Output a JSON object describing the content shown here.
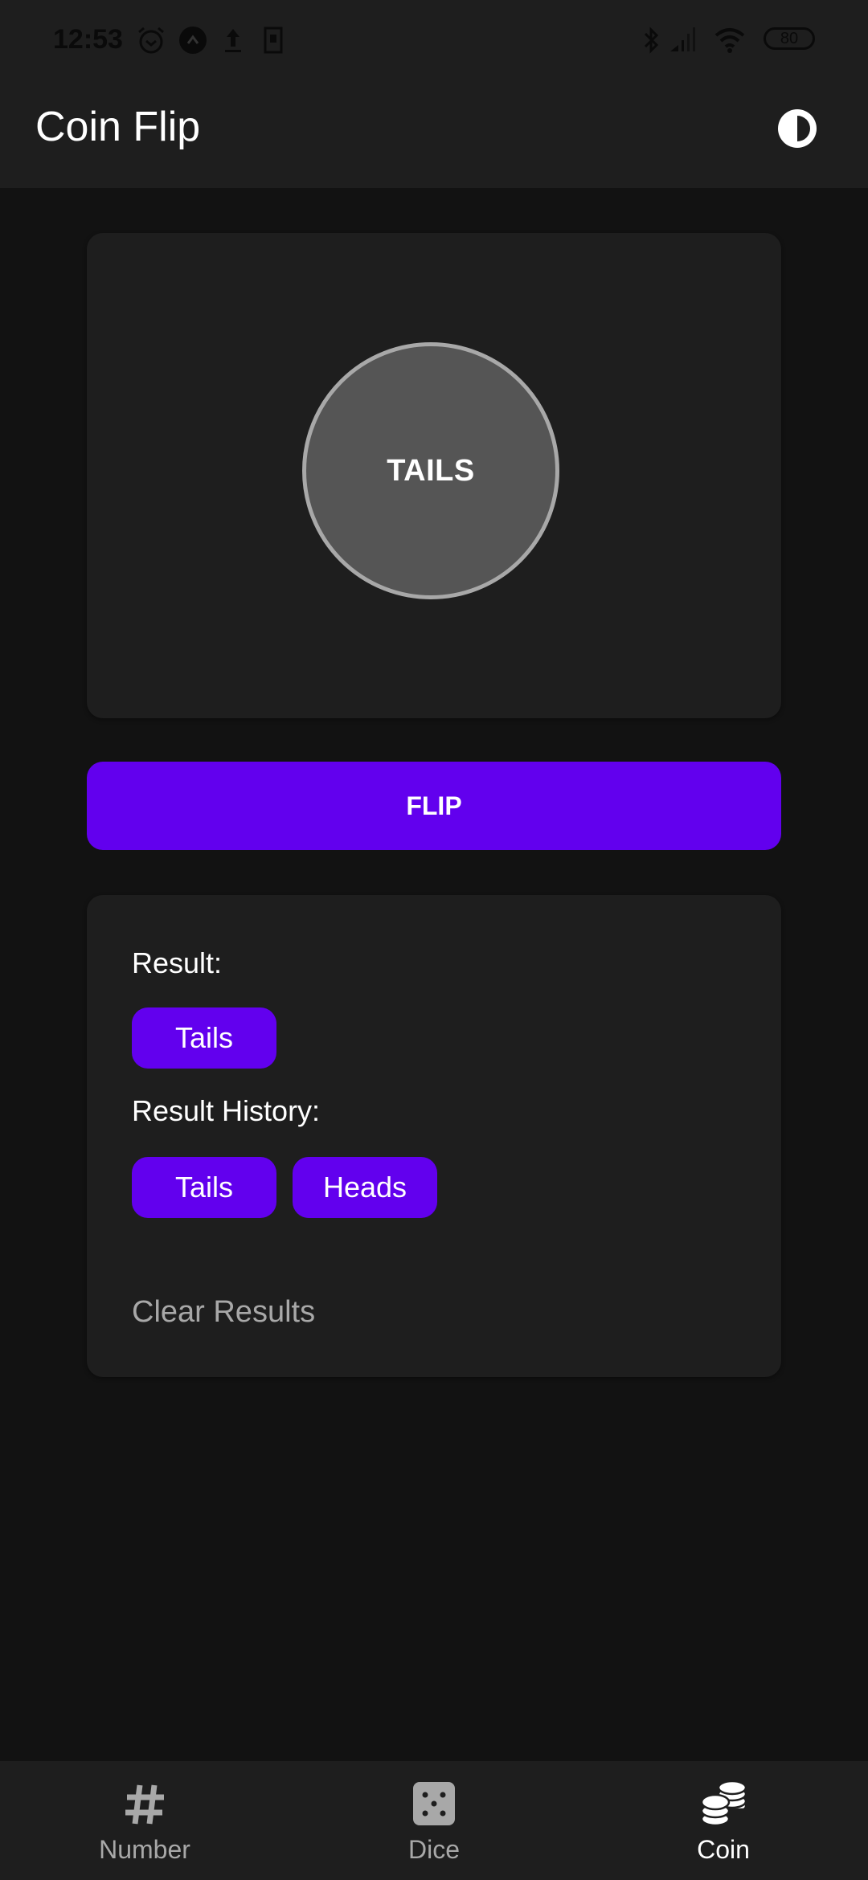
{
  "status_bar": {
    "time": "12:53",
    "left_icons": [
      "alarm-icon",
      "app-notification-icon",
      "upload-icon",
      "sim-icon"
    ],
    "right_icons": [
      "bluetooth-icon",
      "signal-icon",
      "wifi-icon",
      "battery-icon"
    ],
    "battery_level": "80"
  },
  "app_bar": {
    "title": "Coin Flip",
    "theme_toggle_icon": "contrast-icon"
  },
  "coin": {
    "face": "TAILS"
  },
  "flip_button": {
    "label": "FLIP"
  },
  "results": {
    "result_label": "Result:",
    "current_result": "Tails",
    "history_label": "Result History:",
    "history": [
      "Tails",
      "Heads"
    ],
    "clear_label": "Clear Results"
  },
  "colors": {
    "accent": "#6200ee",
    "background": "#121212",
    "surface": "#1e1e1e",
    "coin_fill": "#555555",
    "coin_border": "#a8a8a8",
    "inactive_text": "#a8a8a8"
  },
  "bottom_nav": {
    "items": [
      {
        "label": "Number",
        "icon": "hash-icon",
        "active": false
      },
      {
        "label": "Dice",
        "icon": "dice-icon",
        "active": false
      },
      {
        "label": "Coin",
        "icon": "coins-icon",
        "active": true
      }
    ]
  }
}
